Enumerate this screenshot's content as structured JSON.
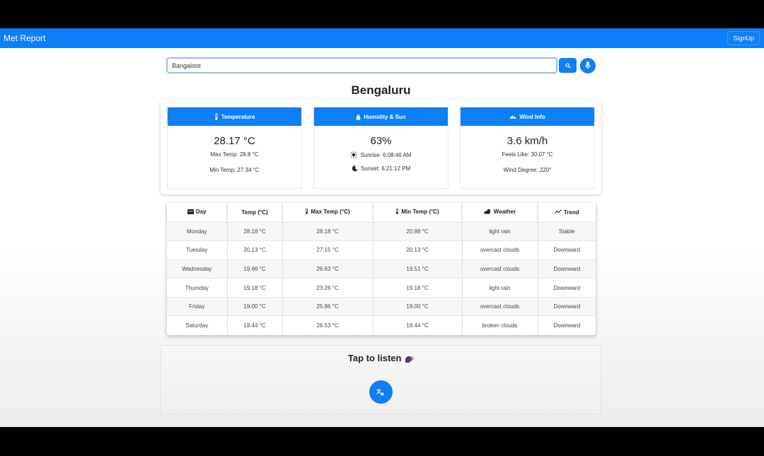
{
  "navbar": {
    "brand": "Met Report",
    "signup_label": "SignUp"
  },
  "search": {
    "value": "Bangalore"
  },
  "city": "Bengaluru",
  "cards": [
    {
      "title": "Temperature",
      "icon": "thermometer-icon",
      "main": "28.17 °C",
      "line1": "Max Temp: 28.8 °C",
      "line2": "Min Temp: 27.34 °C"
    },
    {
      "title": "Humidity & Sun",
      "icon": "droplet-icon",
      "main": "63%",
      "line1": "Sunrise: 6:08:46 AM",
      "line2": "Sunset: 6:21:12 PM"
    },
    {
      "title": "Wind Info",
      "icon": "gauge-icon",
      "main": "3.6 km/h",
      "line1": "Feels Like: 30.07 °C",
      "line2": "Wind Degree: 220°"
    }
  ],
  "table": {
    "headers": [
      "Day",
      "Temp (°C)",
      "Max Temp (°C)",
      "Min Temp (°C)",
      "Weather",
      "Trend"
    ],
    "rows": [
      [
        "Monday",
        "28.18 °C",
        "28.18 °C",
        "20.98 °C",
        "light rain",
        "Stable"
      ],
      [
        "Tuesday",
        "20.13 °C",
        "27.15 °C",
        "20.13 °C",
        "overcast clouds",
        "Downward"
      ],
      [
        "Wednesday",
        "19.66 °C",
        "26.63 °C",
        "19.51 °C",
        "overcast clouds",
        "Downward"
      ],
      [
        "Thursday",
        "19.18 °C",
        "23.26 °C",
        "19.18 °C",
        "light rain",
        "Downward"
      ],
      [
        "Friday",
        "19.00 °C",
        "25.96 °C",
        "19.00 °C",
        "overcast clouds",
        "Downward"
      ],
      [
        "Saturday",
        "18.44 °C",
        "26.53 °C",
        "18.44 °C",
        "broken clouds",
        "Downward"
      ]
    ]
  },
  "listen": {
    "title": "Tap to listen"
  },
  "colors": {
    "accent": "#0d7ff7"
  }
}
